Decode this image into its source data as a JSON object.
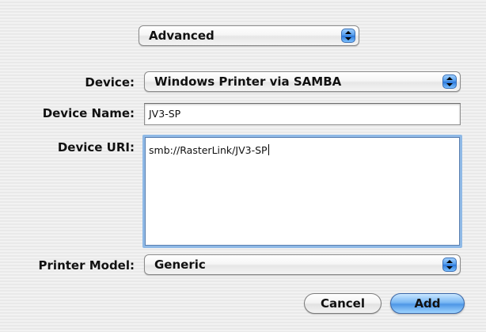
{
  "top_popup": {
    "value": "Advanced",
    "icon": "popup-arrows-icon"
  },
  "device": {
    "label": "Device:",
    "value": "Windows Printer via SAMBA"
  },
  "device_name": {
    "label": "Device Name:",
    "value": "JV3-SP"
  },
  "device_uri": {
    "label": "Device URI:",
    "value": "smb://RasterLink/JV3-SP"
  },
  "printer_model": {
    "label": "Printer Model:",
    "value": "Generic"
  },
  "buttons": {
    "cancel": "Cancel",
    "add": "Add"
  },
  "colors": {
    "accent": "#4f97e6",
    "focus_ring": "#8fb9e6"
  }
}
